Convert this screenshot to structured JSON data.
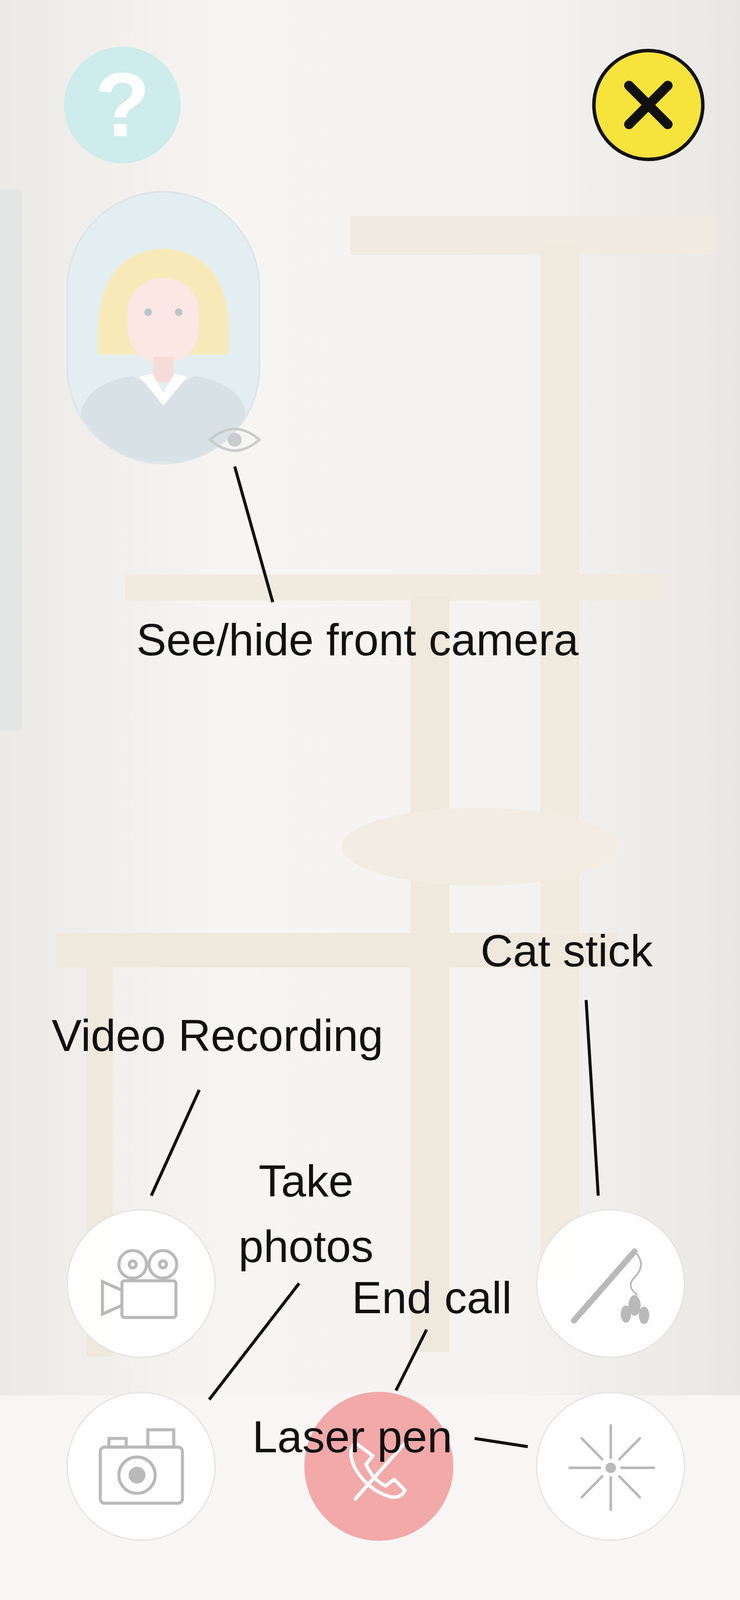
{
  "help_button": {
    "text": "?"
  },
  "front_camera": {
    "label": "See/hide front camera"
  },
  "controls": [
    {
      "kind": "video",
      "label": "Video Recording"
    },
    {
      "kind": "stick",
      "label": "Cat stick"
    },
    {
      "kind": "photo",
      "label": "Take photos"
    },
    {
      "kind": "hangup",
      "label": "End call"
    },
    {
      "kind": "laser",
      "label": "Laser pen"
    }
  ]
}
